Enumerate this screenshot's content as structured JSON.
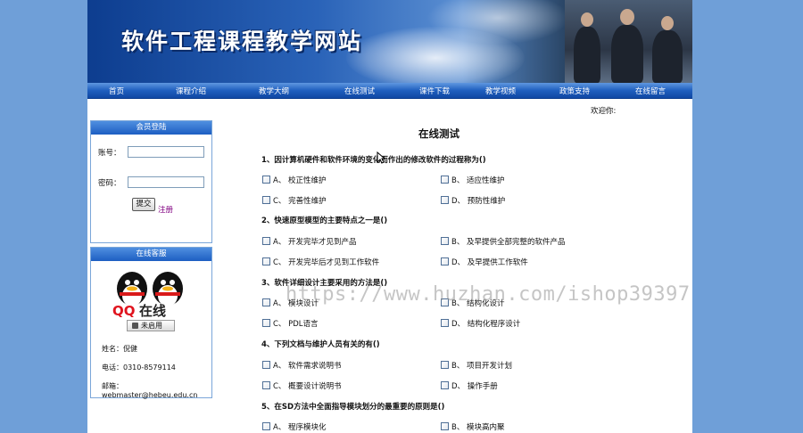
{
  "header": {
    "site_title": "软件工程课程教学网站"
  },
  "nav": {
    "items": [
      {
        "label": "首页"
      },
      {
        "label": "课程介绍"
      },
      {
        "label": "教学大纲"
      },
      {
        "label": "在线测试"
      },
      {
        "label": "课件下载"
      },
      {
        "label": "教学视频"
      },
      {
        "label": "政策支持"
      },
      {
        "label": "在线留言"
      }
    ]
  },
  "welcome": "欢迎你:",
  "login": {
    "title": "会员登陆",
    "account_label": "账号：",
    "account_value": "",
    "password_label": "密码：",
    "password_value": "",
    "submit_label": "提交",
    "register_label": "注册"
  },
  "service": {
    "title": "在线客服",
    "qq_text": "QQ在线",
    "status_label": "未启用",
    "name": "姓名：倪健",
    "phone": "电话：0310-8579114",
    "email": "邮箱：webmaster@hebeu.edu.cn"
  },
  "test": {
    "title": "在线测试",
    "questions": [
      {
        "text": "1、因计算机硬件和软件环境的变化而作出的修改软件的过程称为()",
        "options": [
          "A、 校正性维护",
          "B、 适应性维护",
          "C、 完善性维护",
          "D、 预防性维护"
        ]
      },
      {
        "text": "2、快速原型模型的主要特点之一是()",
        "options": [
          "A、 开发完毕才见到产品",
          "B、 及早提供全部完整的软件产品",
          "C、 开发完毕后才见到工作软件",
          "D、 及早提供工作软件"
        ]
      },
      {
        "text": "3、软件详细设计主要采用的方法是()",
        "options": [
          "A、 模块设计",
          "B、 结构化设计",
          "C、 PDL语言",
          "D、 结构化程序设计"
        ]
      },
      {
        "text": "4、下列文档与维护人员有关的有()",
        "options": [
          "A、 软件需求说明书",
          "B、 项目开发计划",
          "C、 概要设计说明书",
          "D、 操作手册"
        ]
      },
      {
        "text": "5、在SD方法中全面指导模块划分的最重要的原则是()",
        "options": [
          "A、 程序模块化",
          "B、 模块高内聚"
        ]
      }
    ]
  },
  "watermark": "https://www.huzhan.com/ishop39397"
}
